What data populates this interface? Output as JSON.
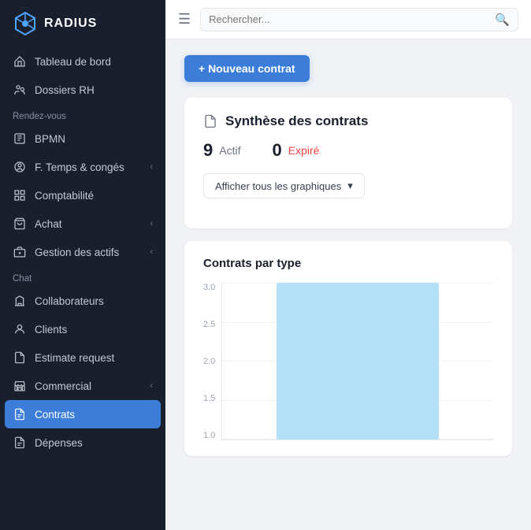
{
  "app": {
    "name": "RADIUS"
  },
  "header": {
    "search_placeholder": "Rechercher...",
    "hamburger_label": "☰"
  },
  "sidebar": {
    "items": [
      {
        "id": "tableau-de-bord",
        "label": "Tableau de bord",
        "icon": "home",
        "has_chevron": false
      },
      {
        "id": "dossiers-rh",
        "label": "Dossiers RH",
        "icon": "users",
        "has_chevron": false
      },
      {
        "id": "rendez-vous-section",
        "label": "Rendez-vous",
        "is_section": true
      },
      {
        "id": "bpmn",
        "label": "BPMN",
        "icon": "book",
        "has_chevron": false
      },
      {
        "id": "f-temps-conges",
        "label": "F. Temps & congés",
        "icon": "user-circle",
        "has_chevron": true
      },
      {
        "id": "comptabilite",
        "label": "Comptabilité",
        "icon": "grid",
        "has_chevron": false
      },
      {
        "id": "achat",
        "label": "Achat",
        "icon": "cart",
        "has_chevron": true
      },
      {
        "id": "gestion-des-actifs",
        "label": "Gestion des actifs",
        "icon": "building",
        "has_chevron": true
      },
      {
        "id": "chat-section",
        "label": "Chat",
        "is_section": true
      },
      {
        "id": "collaborateurs",
        "label": "Collaborateurs",
        "icon": "building2",
        "has_chevron": false
      },
      {
        "id": "clients",
        "label": "Clients",
        "icon": "user",
        "has_chevron": false
      },
      {
        "id": "estimate-request",
        "label": "Estimate request",
        "icon": "file",
        "has_chevron": false
      },
      {
        "id": "commercial",
        "label": "Commercial",
        "icon": "store",
        "has_chevron": true
      },
      {
        "id": "contrats",
        "label": "Contrats",
        "icon": "file-text",
        "has_chevron": false,
        "active": true
      },
      {
        "id": "depenses",
        "label": "Dépenses",
        "icon": "file-text2",
        "has_chevron": false
      }
    ]
  },
  "main": {
    "new_contract_label": "+ Nouveau contrat",
    "section_title": "Synthèse des contrats",
    "stats": {
      "active_count": "9",
      "active_label": "Actif",
      "expired_count": "0",
      "expired_label": "Expiré"
    },
    "dropdown_label": "Afficher tous les graphiques",
    "chart": {
      "title": "Contrats par type",
      "y_labels": [
        "3.0",
        "2.5",
        "2.0",
        "1.5",
        "1.0"
      ],
      "bar_height_percent": 100
    }
  }
}
